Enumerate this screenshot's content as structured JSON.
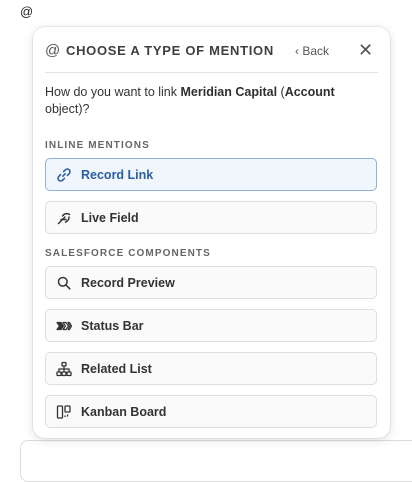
{
  "editor": {
    "at_symbol": "@"
  },
  "popover": {
    "header_glyph": "@",
    "title": "CHOOSE A TYPE OF MENTION",
    "back_label": "‹ Back",
    "close_label": "✕",
    "question": {
      "prefix": "How do you want to link ",
      "record_name": "Meridian Capital",
      "paren_open": " (",
      "object_name": "Account",
      "suffix_bold": "",
      "suffix": " object)?"
    },
    "sections": {
      "inline": {
        "label": "INLINE MENTIONS",
        "options": [
          {
            "label": "Record Link",
            "icon": "link-icon",
            "selected": true
          },
          {
            "label": "Live Field",
            "icon": "live-field-icon",
            "selected": false
          }
        ]
      },
      "salesforce": {
        "label": "SALESFORCE COMPONENTS",
        "options": [
          {
            "label": "Record Preview",
            "icon": "search-icon",
            "selected": false
          },
          {
            "label": "Status Bar",
            "icon": "status-bar-icon",
            "selected": false
          },
          {
            "label": "Related List",
            "icon": "hierarchy-icon",
            "selected": false
          },
          {
            "label": "Kanban Board",
            "icon": "kanban-icon",
            "selected": false
          }
        ]
      }
    },
    "colors": {
      "selected_border": "#8fb0d8",
      "selected_text": "#2b5fa3",
      "option_border": "#dedede"
    }
  }
}
